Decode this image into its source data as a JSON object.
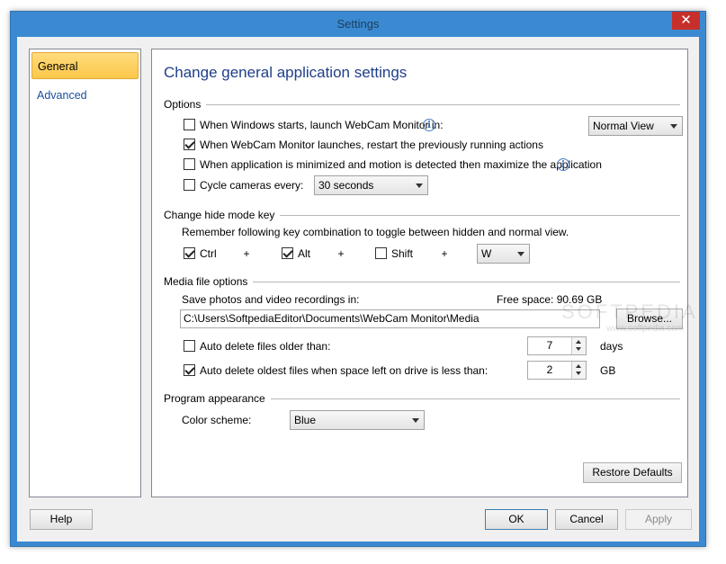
{
  "window": {
    "title": "Settings",
    "close_glyph": "✕"
  },
  "sidebar": {
    "items": [
      {
        "label": "General"
      },
      {
        "label": "Advanced"
      }
    ]
  },
  "panel": {
    "heading": "Change general application settings"
  },
  "options": {
    "section_label": "Options",
    "launch_on_startup": {
      "label": "When Windows starts, launch WebCam Monitor in:",
      "checked": false
    },
    "view_mode": {
      "value": "Normal View"
    },
    "restart_actions": {
      "label": "When WebCam Monitor launches, restart the previously running actions",
      "checked": true
    },
    "maximize_on_motion": {
      "label": "When application is minimized and motion is detected then maximize the application",
      "checked": false
    },
    "cycle_cameras": {
      "label": "Cycle cameras every:",
      "checked": false,
      "interval": "30 seconds"
    },
    "info_glyph": "i"
  },
  "hide_mode": {
    "section_label": "Change hide mode key",
    "description": "Remember following key combination to toggle between hidden and normal view.",
    "ctrl": {
      "label": "Ctrl",
      "checked": true
    },
    "alt": {
      "label": "Alt",
      "checked": true
    },
    "shift": {
      "label": "Shift",
      "checked": false
    },
    "plus": "+",
    "key": {
      "value": "W"
    }
  },
  "media": {
    "section_label": "Media file options",
    "save_label": "Save photos and video recordings in:",
    "free_space": "Free space: 90.69 GB",
    "path": "C:\\Users\\SoftpediaEditor\\Documents\\WebCam Monitor\\Media",
    "browse_label": "Browse...",
    "auto_delete_old": {
      "label": "Auto delete files older than:",
      "checked": false,
      "value": "7",
      "unit": "days"
    },
    "auto_delete_space": {
      "label": "Auto delete oldest files when space left on drive is less than:",
      "checked": true,
      "value": "2",
      "unit": "GB"
    }
  },
  "appearance": {
    "section_label": "Program appearance",
    "color_scheme_label": "Color scheme:",
    "color_scheme_value": "Blue"
  },
  "buttons": {
    "restore_defaults": "Restore Defaults",
    "help": "Help",
    "ok": "OK",
    "cancel": "Cancel",
    "apply": "Apply"
  },
  "watermark": {
    "brand": "SOFTPEDIA",
    "url": "www.softpedia.com"
  },
  "colors": {
    "accent": "#3b8ad1",
    "heading": "#1f3f8a",
    "selected_nav": "#fbc84a",
    "close": "#c7302a"
  }
}
